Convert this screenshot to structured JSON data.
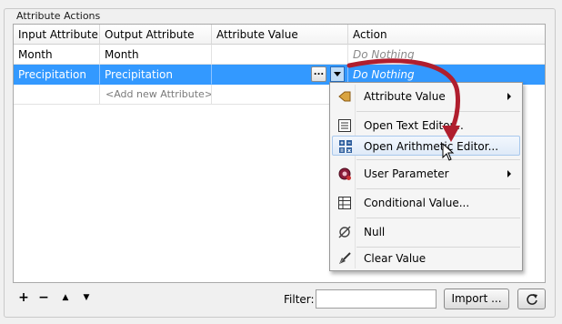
{
  "group": {
    "title": "Attribute Actions"
  },
  "table": {
    "headers": [
      "Input Attribute",
      "Output Attribute",
      "Attribute Value",
      "Action"
    ],
    "rows": [
      {
        "input": "Month",
        "output": "Month",
        "value": "",
        "action": "Do Nothing"
      },
      {
        "input": "Precipitation",
        "output": "Precipitation",
        "value": "",
        "action": "Do Nothing",
        "selected": true
      }
    ],
    "add_row": "<Add new Attribute>",
    "value_button": "..."
  },
  "menu": {
    "items": [
      {
        "label": "Attribute Value",
        "icon": "attribute-value-icon",
        "submenu": true
      },
      {
        "label": "Open Text Editor...",
        "icon": "text-editor-icon"
      },
      {
        "label": "Open Arithmetic Editor...",
        "icon": "arithmetic-editor-icon",
        "hovered": true
      },
      {
        "label": "User Parameter",
        "icon": "user-parameter-icon",
        "submenu": true
      },
      {
        "label": "Conditional Value...",
        "icon": "conditional-value-icon"
      },
      {
        "label": "Null",
        "icon": "null-icon"
      },
      {
        "label": "Clear Value",
        "icon": "clear-value-icon"
      }
    ]
  },
  "toolbar": {
    "add": "+",
    "remove": "−",
    "move_up": "▲",
    "move_down": "▼",
    "filter_label": "Filter:",
    "filter_value": "",
    "import_label": "Import ...",
    "refresh_icon": "refresh-icon"
  },
  "colors": {
    "selection": "#3399ff",
    "annotation_arrow": "#b01e2e"
  }
}
